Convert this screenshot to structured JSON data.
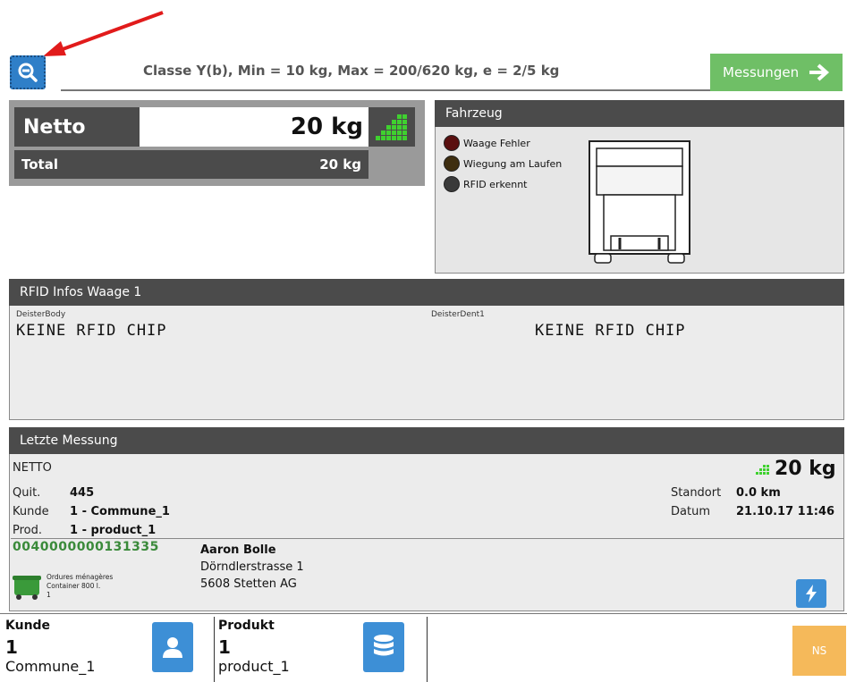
{
  "top": {
    "classification": "Classe Y(b), Min = 10 kg, Max = 200/620 kg, e = 2/5 kg",
    "measurements_button": "Messungen",
    "zoom_icon": "zoom-out-icon",
    "arrow_color": "#e11b1b"
  },
  "weight": {
    "netto_label": "Netto",
    "netto_value": "20 kg",
    "total_label": "Total",
    "total_value": "20 kg"
  },
  "vehicle": {
    "title": "Fahrzeug",
    "indicators": [
      {
        "label": "Waage Fehler",
        "color": "#5a1010"
      },
      {
        "label": "Wiegung am Laufen",
        "color": "#3e2e10"
      },
      {
        "label": "RFID erkennt",
        "color": "#3a3a3a"
      }
    ]
  },
  "rfid": {
    "title": "RFID Infos Waage 1",
    "left_source": "DeisterBody",
    "left_value": "KEINE RFID CHIP",
    "right_source": "DeisterDent1",
    "right_value": "KEINE RFID CHIP"
  },
  "last": {
    "title": "Letzte Messung",
    "type": "NETTO",
    "weight": "20 kg",
    "quit_label": "Quit.",
    "quit_value": "445",
    "kunde_label": "Kunde",
    "kunde_value": "1 - Commune_1",
    "prod_label": "Prod.",
    "prod_value": "1 - product_1",
    "standort_label": "Standort",
    "standort_value": "0.0 km",
    "datum_label": "Datum",
    "datum_value": "21.10.17 11:46",
    "chip_id": "0040000000131335",
    "container_line1": "Ordures ménagères",
    "container_line2": "Container 800 l.",
    "container_line3": "1",
    "owner_name": "Aaron Bolle",
    "owner_street": "Dörndlerstrasse 1",
    "owner_city": "5608 Stetten AG"
  },
  "bottom": {
    "kunde_title": "Kunde",
    "kunde_num": "1",
    "kunde_name": "Commune_1",
    "produkt_title": "Produkt",
    "produkt_num": "1",
    "produkt_name": "product_1",
    "ns_label": "NS"
  },
  "colors": {
    "accent_blue": "#3d8fd6",
    "green": "#6fbf66",
    "signal_green": "#3fd12f",
    "chip_green": "#3a8a3a",
    "ns_orange": "#f5b95a",
    "header_gray": "#4b4b4b"
  }
}
